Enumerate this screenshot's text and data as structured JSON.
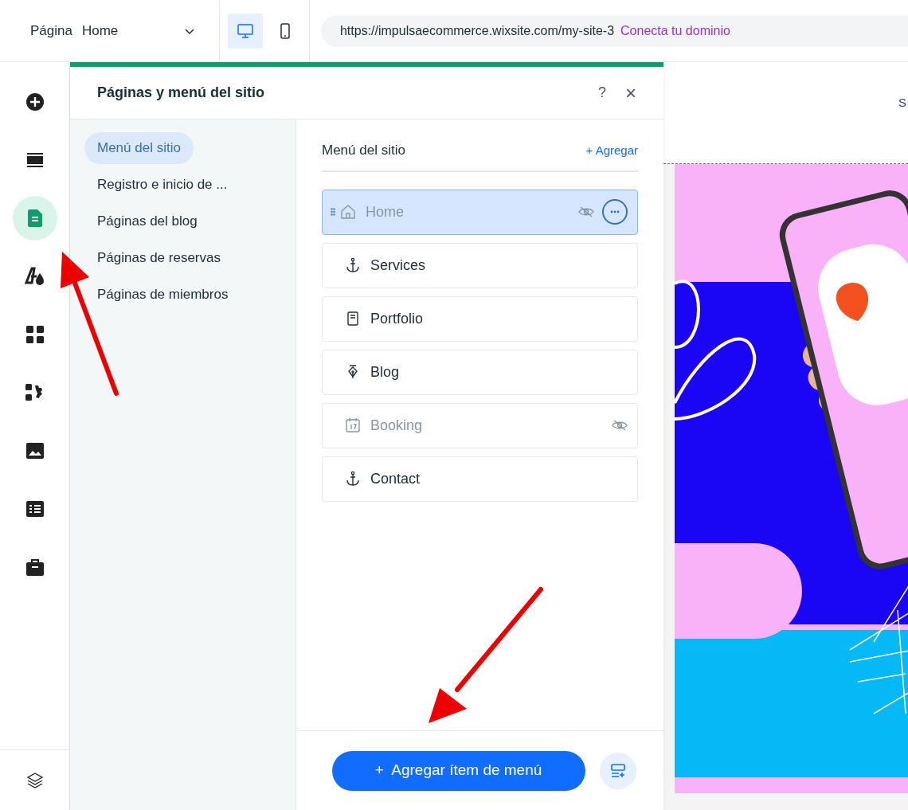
{
  "top_bar": {
    "page_label": "Página",
    "page_dropdown": "Home",
    "devices": [
      {
        "kind": "desktop",
        "selected": true
      },
      {
        "kind": "mobile",
        "selected": false
      }
    ],
    "url": "https://impulsaecommerce.wixsite.com/my-site-3",
    "domain_link": "Conecta tu dominio"
  },
  "rail": [
    {
      "kind": "add",
      "selected": false
    },
    {
      "kind": "sections",
      "selected": false
    },
    {
      "kind": "pages",
      "selected": true
    },
    {
      "kind": "design",
      "selected": false
    },
    {
      "kind": "apps",
      "selected": false
    },
    {
      "kind": "business",
      "selected": false
    },
    {
      "kind": "media",
      "selected": false
    },
    {
      "kind": "cms",
      "selected": false
    },
    {
      "kind": "portfolio",
      "selected": false
    }
  ],
  "panel": {
    "title": "Páginas y menú del sitio",
    "help": "?",
    "close": "×",
    "nav": [
      {
        "label": "Menú del sitio",
        "selected": true
      },
      {
        "label": "Registro e inicio de ...",
        "selected": false
      },
      {
        "label": "Páginas del blog",
        "selected": false
      },
      {
        "label": "Páginas de reservas",
        "selected": false
      },
      {
        "label": "Páginas de miembros",
        "selected": false
      }
    ],
    "menu_title": "Menú del sitio",
    "add_link": "+ Agregar",
    "items": [
      {
        "label": "Home",
        "kind": "home",
        "selected": true,
        "hidden": true
      },
      {
        "label": "Services",
        "kind": "anchor",
        "selected": false,
        "hidden": false
      },
      {
        "label": "Portfolio",
        "kind": "page",
        "selected": false,
        "hidden": false
      },
      {
        "label": "Blog",
        "kind": "blog",
        "selected": false,
        "hidden": false
      },
      {
        "label": "Booking",
        "kind": "booking",
        "selected": false,
        "hidden": true
      },
      {
        "label": "Contact",
        "kind": "anchor",
        "selected": false,
        "hidden": false
      }
    ],
    "add_item_button": "+  Agregar ítem de menú"
  },
  "preview": {
    "nav_text": "S"
  }
}
